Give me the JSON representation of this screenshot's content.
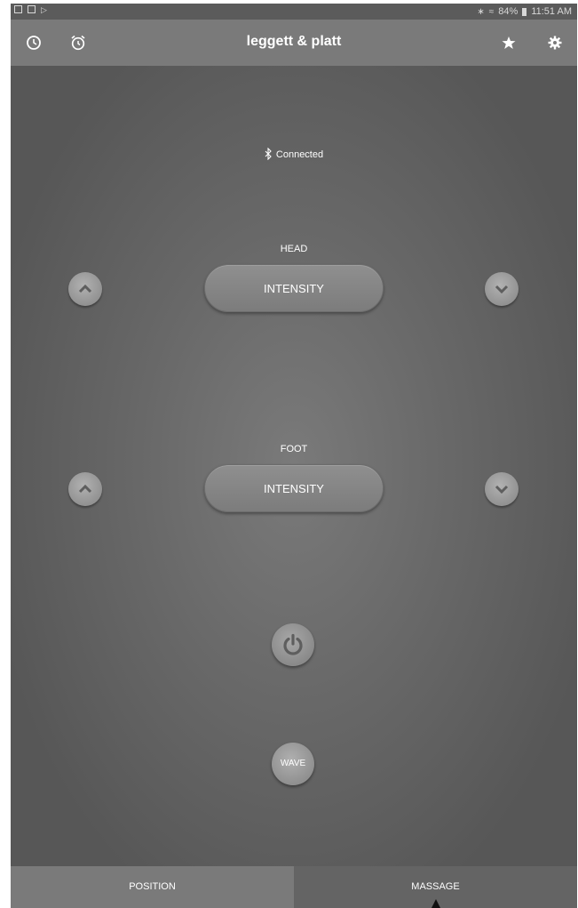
{
  "status_bar": {
    "battery": "84%",
    "time": "11:51 AM",
    "icons_left": [
      "image-icon",
      "flipboard-icon",
      "play-store-icon"
    ],
    "icons_right": [
      "bluetooth-icon",
      "wifi-icon",
      "battery-icon"
    ]
  },
  "app_bar": {
    "title": "leggett & platt",
    "left_icons": [
      "clock-icon",
      "alarm-icon"
    ],
    "right_icons": [
      "star-icon",
      "settings-icon"
    ]
  },
  "connection": {
    "status": "Connected",
    "icon": "bluetooth-icon"
  },
  "zones": [
    {
      "label": "HEAD",
      "button_label": "INTENSITY",
      "up_icon": "chevron-up-icon",
      "down_icon": "chevron-down-icon"
    },
    {
      "label": "FOOT",
      "button_label": "INTENSITY",
      "up_icon": "chevron-up-icon",
      "down_icon": "chevron-down-icon"
    }
  ],
  "power": {
    "icon": "power-icon"
  },
  "wave": {
    "label": "WAVE"
  },
  "tabs": [
    {
      "label": "POSITION",
      "selected": false
    },
    {
      "label": "MASSAGE",
      "selected": true
    }
  ],
  "colors": {
    "app_bar": "#7a7a7a",
    "background": "#585858",
    "button": "#8a8a8a",
    "text": "#ffffff"
  }
}
